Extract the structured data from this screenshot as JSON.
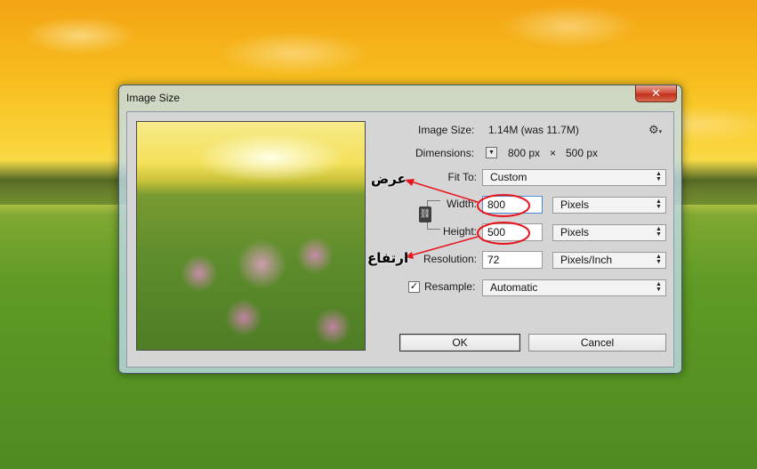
{
  "dialog": {
    "title": "Image Size",
    "close_glyph": "✕",
    "image_size_label": "Image Size:",
    "image_size_value": "1.14M (was 11.7M)",
    "dimensions_label": "Dimensions:",
    "dimensions_width": "800 px",
    "dimensions_times": "×",
    "dimensions_height": "500 px",
    "fit_to_label": "Fit To:",
    "fit_to_value": "Custom",
    "width_label": "Width:",
    "width_value": "800",
    "width_unit": "Pixels",
    "height_label": "Height:",
    "height_value": "500",
    "height_unit": "Pixels",
    "resolution_label": "Resolution:",
    "resolution_value": "72",
    "resolution_unit": "Pixels/Inch",
    "resample_label": "Resample:",
    "resample_checked": "✓",
    "resample_value": "Automatic",
    "ok_label": "OK",
    "cancel_label": "Cancel"
  },
  "annotations": {
    "width_note": "عرض",
    "height_note": "ارتفاع",
    "color": "#e8141b"
  }
}
